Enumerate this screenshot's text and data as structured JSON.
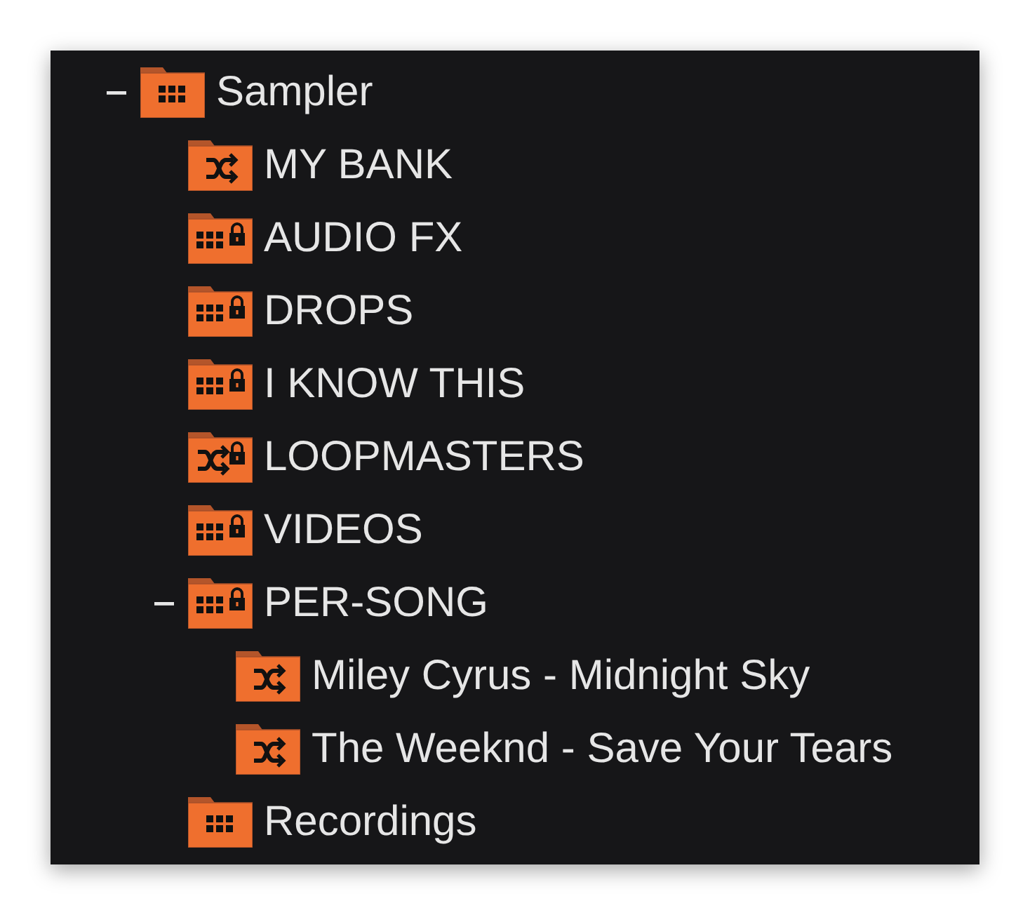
{
  "tree": [
    {
      "label": "Sampler",
      "kind": "grid",
      "locked": false,
      "expanded": true,
      "children": [
        {
          "label": "MY BANK",
          "kind": "shuffle",
          "locked": false
        },
        {
          "label": "AUDIO FX",
          "kind": "grid",
          "locked": true
        },
        {
          "label": "DROPS",
          "kind": "grid",
          "locked": true
        },
        {
          "label": "I KNOW THIS",
          "kind": "grid",
          "locked": true
        },
        {
          "label": "LOOPMASTERS",
          "kind": "shuffle",
          "locked": true
        },
        {
          "label": "VIDEOS",
          "kind": "grid",
          "locked": true
        },
        {
          "label": "PER-SONG",
          "kind": "grid",
          "locked": true,
          "expanded": true,
          "children": [
            {
              "label": "Miley Cyrus - Midnight Sky",
              "kind": "shuffle",
              "locked": false
            },
            {
              "label": "The Weeknd - Save Your Tears",
              "kind": "shuffle",
              "locked": false
            }
          ]
        },
        {
          "label": "Recordings",
          "kind": "grid",
          "locked": false
        }
      ]
    }
  ]
}
